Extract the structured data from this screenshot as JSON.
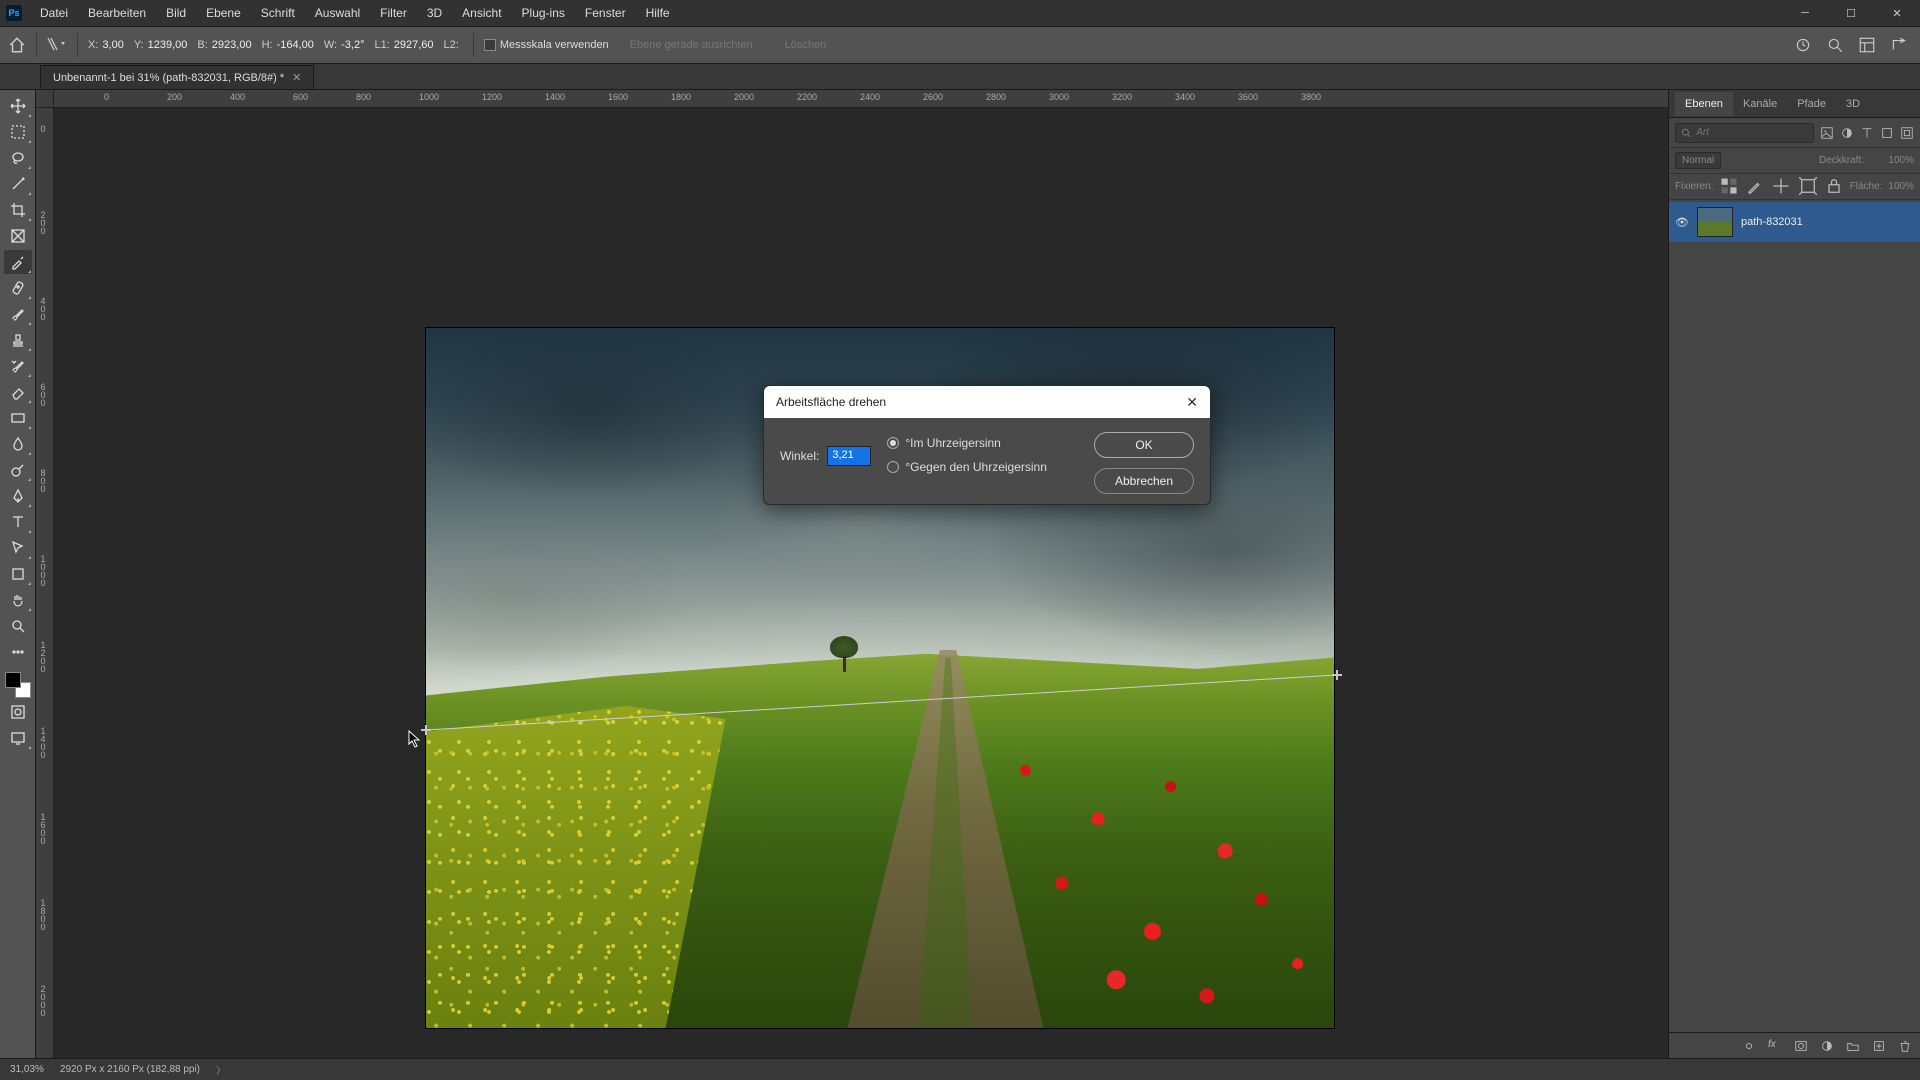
{
  "app": {
    "ps": "Ps"
  },
  "menu": [
    "Datei",
    "Bearbeiten",
    "Bild",
    "Ebene",
    "Schrift",
    "Auswahl",
    "Filter",
    "3D",
    "Ansicht",
    "Plug-ins",
    "Fenster",
    "Hilfe"
  ],
  "options": {
    "x_label": "X:",
    "x_value": "3,00",
    "y_label": "Y:",
    "y_value": "1239,00",
    "b_label": "B:",
    "b_value": "2923,00",
    "h_label": "H:",
    "h_value": "-164,00",
    "w_label": "W:",
    "w_value": "-3,2°",
    "l1_label": "L1:",
    "l1_value": "2927,60",
    "l2_label": "L2:",
    "l2_value": "",
    "use_scale": "Messskala verwenden",
    "straighten": "Ebene gerade ausrichten",
    "clear": "Löschen"
  },
  "doc_tab": "Unbenannt-1 bei 31% (path-832031, RGB/8#) *",
  "ruler_h": [
    "0",
    "200",
    "400",
    "600",
    "800",
    "1000",
    "1200",
    "1400",
    "1600",
    "1800",
    "2000",
    "2200",
    "2400",
    "2600",
    "2800",
    "3000",
    "3200",
    "3400",
    "3600",
    "3800"
  ],
  "ruler_v": [
    "0",
    "200",
    "400",
    "600",
    "800",
    "1000",
    "1200",
    "1400",
    "1600",
    "1800",
    "2000"
  ],
  "dialog": {
    "title": "Arbeitsfläche drehen",
    "angle_label": "Winkel:",
    "angle_value": "3,21",
    "cw": "°Im Uhrzeigersinn",
    "ccw": "°Gegen den Uhrzeigersinn",
    "ok": "OK",
    "cancel": "Abbrechen"
  },
  "panels": {
    "tabs": [
      "Ebenen",
      "Kanäle",
      "Pfade",
      "3D"
    ],
    "search_placeholder": "Art",
    "blend": "Normal",
    "opacity_label": "Deckkraft:",
    "opacity_value": "100%",
    "lock_label": "Fixieren:",
    "fill_label": "Fläche:",
    "fill_value": "100%",
    "layer_name": "path-832031"
  },
  "status": {
    "zoom": "31,03%",
    "doc": "2920 Px x 2160 Px (182,88 ppi)"
  }
}
